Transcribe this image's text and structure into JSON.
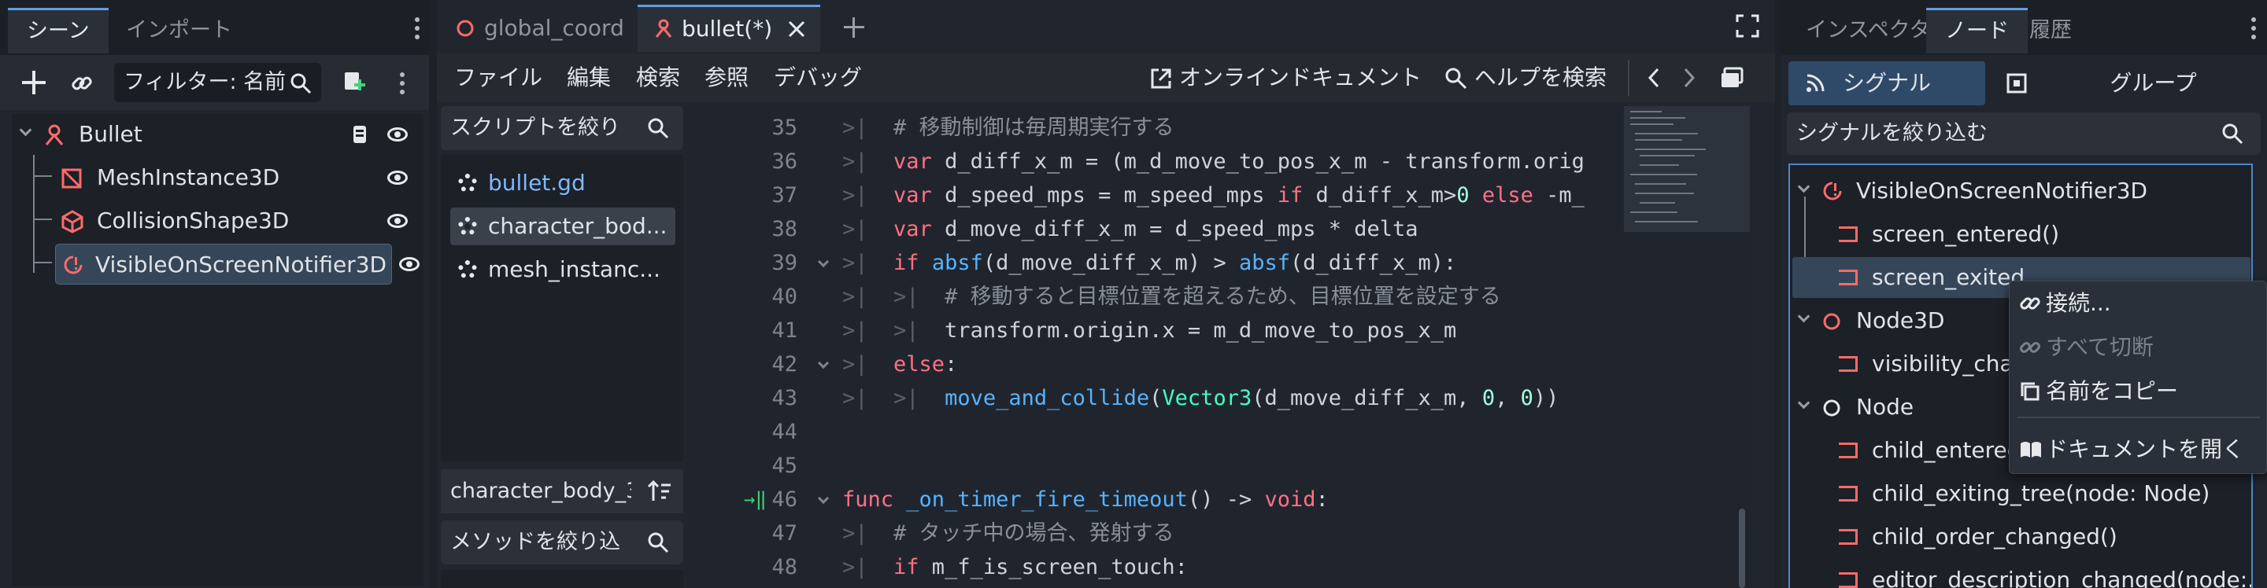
{
  "left_dock": {
    "tabs": [
      "シーン",
      "インポート"
    ],
    "filter_placeholder": "フィルター: 名前",
    "tree": [
      {
        "label": "Bullet",
        "icon": "bullet-node-icon"
      },
      {
        "label": "MeshInstance3D",
        "icon": "mesh-instance-icon"
      },
      {
        "label": "CollisionShape3D",
        "icon": "collision-shape-icon"
      },
      {
        "label": "VisibleOnScreenNotifier3D",
        "icon": "notifier-icon"
      }
    ]
  },
  "editor": {
    "doc_tabs": [
      {
        "label": "global_coord"
      },
      {
        "label": "bullet(*)"
      }
    ],
    "menu": {
      "file": "ファイル",
      "edit": "編集",
      "search": "検索",
      "go_to": "参照",
      "debug": "デバッグ",
      "online_docs": "オンラインドキュメント",
      "search_help": "ヘルプを検索"
    },
    "script_filter_placeholder": "スクリプトを絞り",
    "scripts": [
      "bullet.gd",
      "character_bod...",
      "mesh_instanc..."
    ],
    "current_script": "character_body_3",
    "method_filter_placeholder": "メソッドを絞り込",
    "code_lines": [
      {
        "n": "35",
        "html": "<span class='c'># 移動制御は毎周期実行する</span>"
      },
      {
        "n": "36",
        "html": "<span class='k'>var</span> d_diff_x_m = (m_d_move_to_pos_x_m - transform.orig"
      },
      {
        "n": "37",
        "html": "<span class='k'>var</span> d_speed_mps = m_speed_mps <span class='k'>if</span> d_diff_x_m&gt;<span class='n'>0</span> <span class='k'>else</span> -m_"
      },
      {
        "n": "38",
        "html": "<span class='k'>var</span> d_move_diff_x_m = d_speed_mps * delta"
      },
      {
        "n": "39",
        "html": "<span class='k'>if</span> <span class='f'>absf</span>(d_move_diff_x_m) &gt; <span class='f'>absf</span>(d_diff_x_m):"
      },
      {
        "n": "40",
        "html": "<span class='tabmark'>&gt;|</span>  <span class='c'># 移動すると目標位置を超えるため、目標位置を設定する</span>"
      },
      {
        "n": "41",
        "html": "<span class='tabmark'>&gt;|</span>  transform.origin.x = m_d_move_to_pos_x_m"
      },
      {
        "n": "42",
        "html": "<span class='k'>else</span>:"
      },
      {
        "n": "43",
        "html": "<span class='tabmark'>&gt;|</span>  <span class='f'>move_and_collide</span>(<span class='t'>Vector3</span>(d_move_diff_x_m, <span class='n'>0</span>, <span class='n'>0</span>))"
      },
      {
        "n": "44",
        "html": ""
      },
      {
        "n": "45",
        "html": ""
      },
      {
        "n": "46",
        "html": "<span class='k'>func</span> <span class='f'>_on_timer_fire_timeout</span>() -&gt; <span class='k'>void</span>:"
      },
      {
        "n": "47",
        "html": "<span class='c'># タッチ中の場合、発射する</span>"
      },
      {
        "n": "48",
        "html": "<span class='k'>if</span> m_f_is_screen_touch:"
      }
    ]
  },
  "right_dock": {
    "tabs": [
      "インスペクター",
      "ノード",
      "履歴"
    ],
    "signals_button": "シグナル",
    "groups_button": "グループ",
    "signal_filter_placeholder": "シグナルを絞り込む",
    "tree": {
      "notifier_header": "VisibleOnScreenNotifier3D",
      "screen_entered": "screen_entered()",
      "screen_exited": "screen_exited",
      "node3d_header": "Node3D",
      "visibility_changed": "visibility_char",
      "node_header": "Node",
      "child_entered": "child_entered",
      "child_exiting": "child_exiting_tree(node: Node)",
      "child_order": "child_order_changed()",
      "editor_desc": "editor_description_changed(node:..."
    },
    "context_menu": {
      "connect": "接続...",
      "disconnect_all": "すべて切断",
      "copy_name": "名前をコピー",
      "open_docs": "ドキュメントを開く"
    }
  },
  "colors": {
    "accent": "#5fa0e6",
    "keyword": "#ff7086",
    "function": "#57b3ff",
    "signal_icon": "#ff6a6a"
  }
}
